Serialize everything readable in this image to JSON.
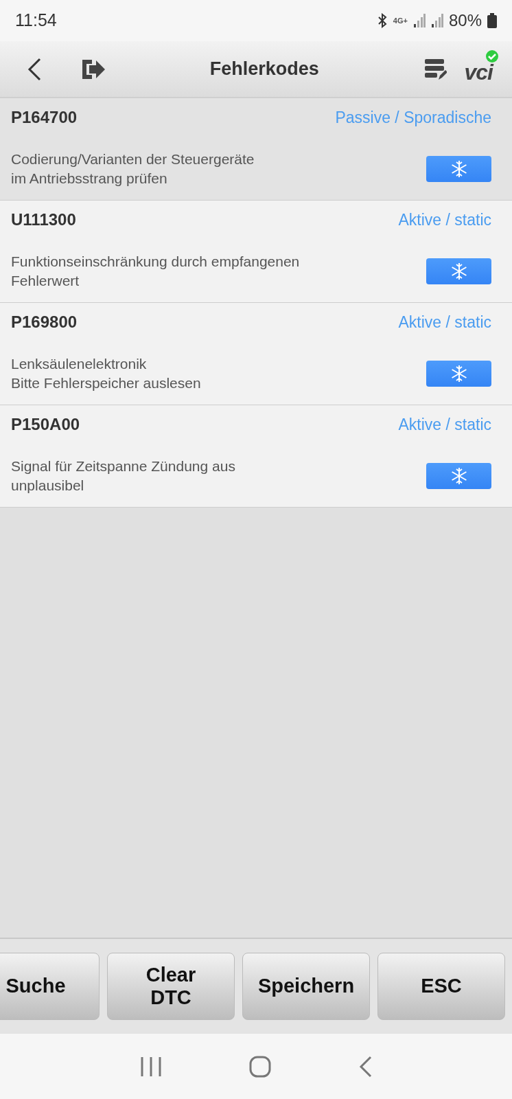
{
  "status_bar": {
    "time": "11:54",
    "network": "4G+",
    "battery": "80%"
  },
  "header": {
    "title": "Fehlerkodes",
    "vci": "vci"
  },
  "codes": [
    {
      "code": "P164700",
      "status": "Passive / Sporadische",
      "description": "Codierung/Varianten der Steuergeräte\nim Antriebsstrang prüfen",
      "selected": true
    },
    {
      "code": "U111300",
      "status": "Aktive / static",
      "description": "Funktionseinschränkung durch empfangenen\nFehlerwert",
      "selected": false
    },
    {
      "code": "P169800",
      "status": "Aktive / static",
      "description": "Lenksäulenelektronik\nBitte Fehlerspeicher auslesen",
      "selected": false
    },
    {
      "code": "P150A00",
      "status": "Aktive / static",
      "description": "Signal für Zeitspanne Zündung aus\nunplausibel",
      "selected": false
    }
  ],
  "buttons": [
    "Suche",
    "Clear\nDTC",
    "Speichern",
    "ESC"
  ]
}
